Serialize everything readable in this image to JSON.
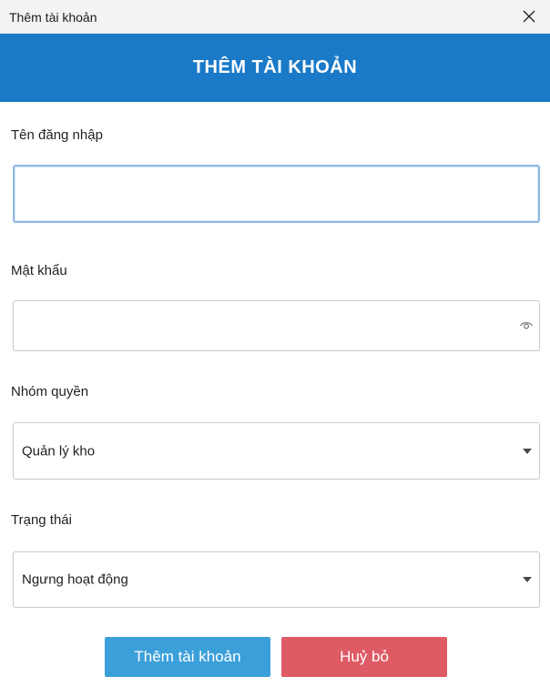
{
  "window": {
    "title": "Thêm tài khoản",
    "close_icon": "close-icon"
  },
  "header": {
    "heading": "THÊM TÀI KHOẢN",
    "background": "#1a7ac7"
  },
  "form": {
    "username": {
      "label": "Tên đăng nhập",
      "value": "",
      "placeholder": ""
    },
    "password": {
      "label": "Mật khẩu",
      "value": "",
      "placeholder": "",
      "toggle_icon": "eye-icon"
    },
    "role": {
      "label": "Nhóm quyền",
      "selected": "Quản lý kho"
    },
    "status": {
      "label": "Trạng thái",
      "selected": "Ngưng hoạt động"
    }
  },
  "actions": {
    "submit_label": "Thêm tài khoản",
    "cancel_label": "Huỷ bỏ",
    "submit_color": "#3b9fd9",
    "cancel_color": "#de5a64"
  }
}
